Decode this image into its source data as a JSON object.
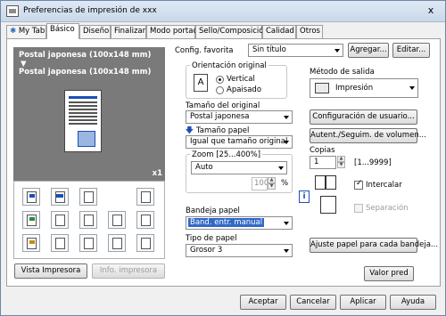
{
  "window": {
    "title": "Preferencias de impresión de xxx",
    "close_glyph": "x"
  },
  "tabs": [
    {
      "label": "My Tab"
    },
    {
      "label": "Básico"
    },
    {
      "label": "Diseño"
    },
    {
      "label": "Finalizar"
    },
    {
      "label": "Modo portada"
    },
    {
      "label": "Sello/Composición"
    },
    {
      "label": "Calidad"
    },
    {
      "label": "Otros"
    }
  ],
  "preview": {
    "line1": "Postal japonesa (100x148 mm)",
    "arrow": "▼",
    "line2": "Postal japonesa (100x148 mm)",
    "copies_badge": "x1"
  },
  "left_buttons": {
    "vista": "Vista Impresora",
    "info": "Info. impresora"
  },
  "favorites": {
    "label": "Config. favorita",
    "value": "Sin título",
    "add": "Agregar...",
    "edit": "Editar..."
  },
  "orientation": {
    "title": "Orientación original",
    "vertical": "Vertical",
    "landscape": "Apaisado",
    "selected": "vertical"
  },
  "original_size": {
    "label": "Tamaño del original",
    "value": "Postal japonesa"
  },
  "paper_size": {
    "label": "Tamaño papel",
    "value": "Igual que tamaño original"
  },
  "zoom": {
    "title": "Zoom [25...400%]",
    "mode": "Auto",
    "value": "100",
    "unit": "%"
  },
  "paper_tray": {
    "label": "Bandeja papel",
    "value": "Band. entr. manual"
  },
  "paper_type": {
    "label": "Tipo de papel",
    "value": "Grosor 3"
  },
  "output": {
    "label": "Método de salida",
    "value": "Impresión"
  },
  "buttons": {
    "user_config": "Configuración de usuario...",
    "auth": "Autent./Seguim. de volumen...",
    "adjust_paper": "Ajuste papel para cada bandeja...",
    "default_value": "Valor pred",
    "accept": "Aceptar",
    "cancel": "Cancelar",
    "apply": "Aplicar",
    "help": "Ayuda"
  },
  "copies": {
    "label": "Copias",
    "value": "1",
    "range": "[1...9999]",
    "collate_label": "Intercalar",
    "collate_checked": true,
    "separate_label": "Separación",
    "separate_checked": false
  },
  "colors": {
    "highlight": "#3169c6",
    "accent_blue": "#1b4fb5",
    "preview_bg": "#7a7a7a"
  }
}
